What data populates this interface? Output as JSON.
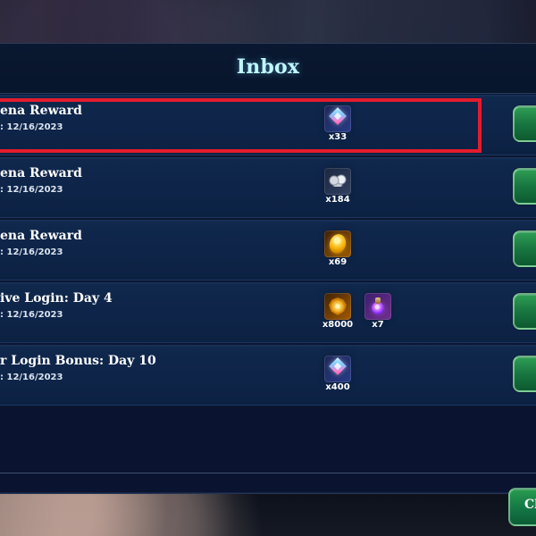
{
  "title": "Inbox",
  "messages": [
    {
      "title": "ena Reward",
      "date": ": 12/16/2023",
      "rewards": [
        {
          "icon": "gem-icon",
          "qty": "x33"
        }
      ]
    },
    {
      "title": "ena Reward",
      "date": ": 12/16/2023",
      "rewards": [
        {
          "icon": "silver-ore-icon",
          "qty": "x184"
        }
      ]
    },
    {
      "title": "ena Reward",
      "date": ": 12/16/2023",
      "rewards": [
        {
          "icon": "gold-coin-icon",
          "qty": "x69"
        }
      ]
    },
    {
      "title": "ive Login: Day 4",
      "date": ": 12/16/2023",
      "rewards": [
        {
          "icon": "bronze-medal-icon",
          "qty": "x8000"
        },
        {
          "icon": "purple-potion-icon",
          "qty": "x7"
        }
      ]
    },
    {
      "title": "r Login Bonus: Day 10",
      "date": ": 12/16/2023",
      "rewards": [
        {
          "icon": "gem-icon",
          "qty": "x400"
        }
      ]
    }
  ],
  "close_button_label": "Cl",
  "colors": {
    "panel": "#0b1530",
    "row": "#10284d",
    "title": "#bff6ff",
    "claim_button": "#1b7b44",
    "highlight": "#e21c2d"
  }
}
